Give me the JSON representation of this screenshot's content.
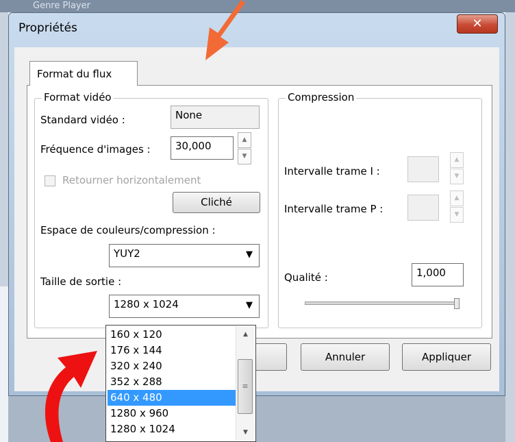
{
  "background": {
    "window_title": "Genre Player"
  },
  "dialog": {
    "title": "Propriétés",
    "close_glyph": "✕",
    "tab_label": "Format du flux",
    "video_format": {
      "legend": "Format vidéo",
      "standard_label": "Standard vidéo :",
      "standard_value": "None",
      "frame_rate_label": "Fréquence d'images :",
      "frame_rate_value": "30,000",
      "flip_label": "Retourner horizontalement",
      "snapshot_button": "Cliché",
      "colorspace_label": "Espace de couleurs/compression :",
      "colorspace_value": "YUY2",
      "output_size_label": "Taille de sortie :",
      "output_size_value": "1280 x 1024"
    },
    "compression": {
      "legend": "Compression",
      "i_frame_label": "Intervalle trame I :",
      "p_frame_label": "Intervalle trame P :",
      "quality_label": "Qualité :",
      "quality_value": "1,000",
      "quality_slider_level": 1.0
    },
    "buttons": {
      "cancel": "Annuler",
      "apply": "Appliquer"
    },
    "size_options": [
      "160 x 120",
      "176 x 144",
      "320 x 240",
      "352 x 288",
      "640 x 480",
      "1280 x 960",
      "1280 x 1024"
    ],
    "size_highlighted": "640 x 480"
  },
  "annotation_colors": {
    "top_arrow": "#f26a35",
    "bottom_arrow": "#ee1111"
  }
}
